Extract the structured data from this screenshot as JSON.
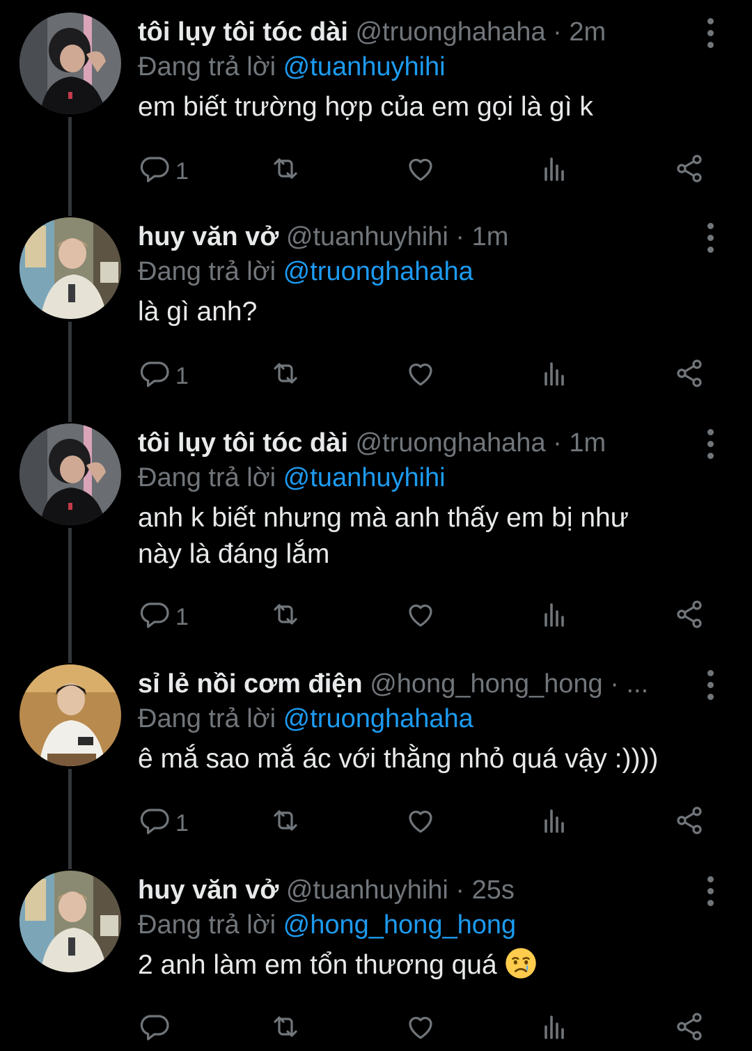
{
  "colors": {
    "background": "#000000",
    "text": "#e7e9ea",
    "muted": "#71767b",
    "link": "#1d9bf0",
    "thread_line": "#333639"
  },
  "reply_prefix": "Đang trả lời",
  "tweets": [
    {
      "display_name": "tôi lụy tôi tóc dài",
      "handle": "@truonghahaha",
      "separator": "·",
      "time": "2m",
      "replying_to": "@tuanhuyhihi",
      "text": "em biết trường hợp của em gọi là gì k",
      "reply_count": "1",
      "avatar": "avatar-truonghahaha"
    },
    {
      "display_name": "huy văn vở",
      "handle": "@tuanhuyhihi",
      "separator": "·",
      "time": "1m",
      "replying_to": "@truonghahaha",
      "text": "là gì anh?",
      "reply_count": "1",
      "avatar": "avatar-tuanhuyhihi"
    },
    {
      "display_name": "tôi lụy tôi tóc dài",
      "handle": "@truonghahaha",
      "separator": "·",
      "time": "1m",
      "replying_to": "@tuanhuyhihi",
      "text_lines": [
        "anh k biết nhưng mà anh thấy em bị như",
        "này là đáng lắm"
      ],
      "reply_count": "1",
      "avatar": "avatar-truonghahaha"
    },
    {
      "display_name": "sỉ lẻ nồi cơm điện",
      "handle": "@hong_hong_hong",
      "separator": "·",
      "time": "...",
      "replying_to": "@truonghahaha",
      "text": "ê mắ sao mắ ác với thằng nhỏ quá vậy :))))",
      "reply_count": "1",
      "avatar": "avatar-hong_hong_hong"
    },
    {
      "display_name": "huy văn vở",
      "handle": "@tuanhuyhihi",
      "separator": "·",
      "time": "25s",
      "replying_to": "@hong_hong_hong",
      "text": "2 anh làm em tổn thương quá",
      "emoji": "crying-face-emoji",
      "reply_count": "",
      "avatar": "avatar-tuanhuyhihi"
    }
  ],
  "icons": {
    "reply": "reply-icon",
    "retweet": "retweet-icon",
    "like": "heart-icon",
    "views": "views-icon",
    "share": "share-icon",
    "more": "more-vertical-icon"
  }
}
